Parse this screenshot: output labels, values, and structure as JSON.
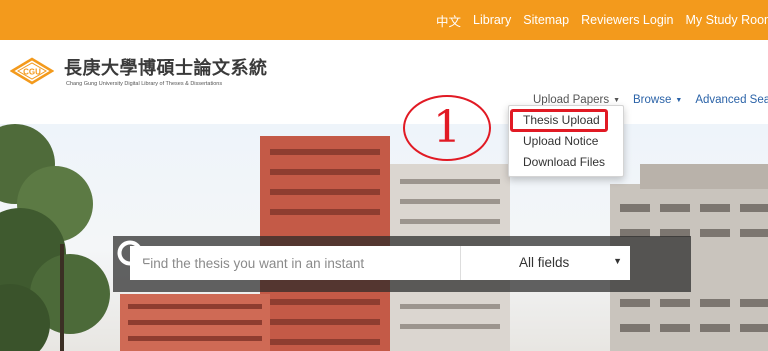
{
  "topbar": {
    "links": [
      "中文",
      "Library",
      "Sitemap",
      "Reviewers Login",
      "My Study Room"
    ]
  },
  "brand": {
    "logo_text": "CGU",
    "title": "長庚大學博碩士論文系統",
    "subtitle": "Chang Gung University Digital Library of Theses & Dissertations"
  },
  "nav": {
    "upload_papers": "Upload Papers",
    "browse": "Browse",
    "advanced_search": "Advanced Search"
  },
  "dropdown": {
    "items": [
      "Thesis Upload",
      "Upload Notice",
      "Download Files"
    ]
  },
  "annotation": {
    "step": "1"
  },
  "search": {
    "placeholder": "Find the thesis you want in an instant",
    "field_selected": "All fields"
  },
  "colors": {
    "topbar": "#f39a1c",
    "highlight": "#e11a24",
    "nav_active": "#2b63a8"
  }
}
